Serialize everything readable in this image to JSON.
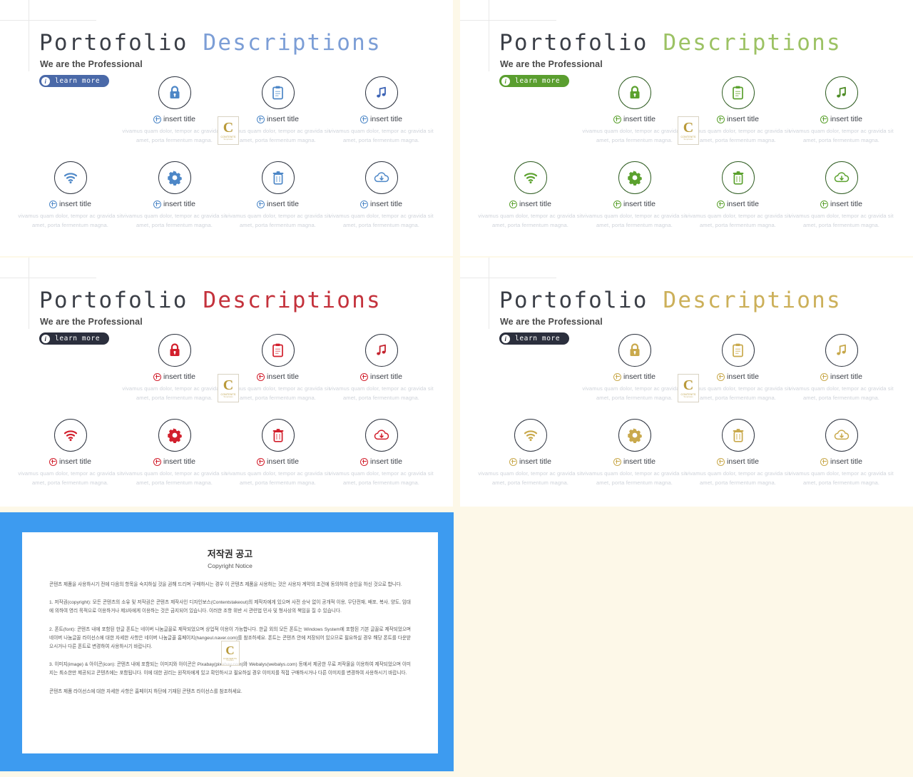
{
  "page": {
    "background": "#fdf8e8",
    "panel_background": "#ffffff"
  },
  "common": {
    "title_part1": "Portofolio",
    "title_part2": "Descriptions",
    "subtitle": "We are the Professional",
    "learn_more": "learn more",
    "info_glyph": "i",
    "cell_title": "insert title",
    "cell_body": "vivamus quam dolor, tempor ac gravida sit amet, porta fermentum magna.",
    "watermark": {
      "letter": "C",
      "line1": "CONTENTS",
      "line2": "Templates"
    },
    "icons_row1": [
      "lock-icon",
      "clipboard-icon",
      "music-note-icon"
    ],
    "icons_row2": [
      "wifi-icon",
      "gear-icon",
      "trash-icon",
      "cloud-download-icon"
    ]
  },
  "panels": [
    {
      "id": "panel-blue",
      "accent": "#4a69a8",
      "icon_color": "#4d87c7",
      "circle_border": "#2e3440",
      "button_bg": "#4a69a8",
      "button_text": "#ffffff",
      "title_accent": "#7c9ed6",
      "title_main": "#3b3f47",
      "plus_color": "#4d87c7"
    },
    {
      "id": "panel-green",
      "accent": "#5a9e2f",
      "icon_color": "#5ba12e",
      "circle_border": "#2f5d22",
      "button_bg": "#5a9e2f",
      "button_text": "#ffffff",
      "title_accent": "#9cc264",
      "title_main": "#3b3f47",
      "plus_color": "#5ba12e"
    },
    {
      "id": "panel-red",
      "accent": "#c4232e",
      "icon_color": "#d21f2c",
      "circle_border": "#2e3440",
      "button_bg": "#2b2f3d",
      "button_text": "#ffffff",
      "title_accent": "#c4323c",
      "title_main": "#3b3f47",
      "plus_color": "#d21f2c"
    },
    {
      "id": "panel-gold",
      "accent": "#c7a84b",
      "icon_color": "#c9a94c",
      "circle_border": "#2e3440",
      "button_bg": "#2b2f3d",
      "button_text": "#ffffff",
      "title_accent": "#ccb05a",
      "title_main": "#3b3f47",
      "plus_color": "#c9a94c"
    }
  ],
  "copyright": {
    "frame_color": "#3d9bf0",
    "title_ko": "저작권 공고",
    "title_en": "Copyright Notice",
    "intro": "콘텐츠 제품을 사용하시기 전에 다음의 항목을 숙지하실 것을 권해 드리며 구매하시는 경우 이 콘텐츠 제품을 사용하는 것은 사용자 계약의 조건에 동의하여 승인을 하신 것으로 합니다.",
    "p1": "1. 저작권(copyright): 모든 콘텐츠의 소유 및 저작권은 콘텐츠 제작사인 디자인보스(Contentstakeout)의 제작자에게 있으며 사전 승낙 없이 공개적 이용, 무단전재, 배포, 복사, 양도, 임대에 의하여 영리 목적으로 이용하거나 제3자에게 이용하는 것은 금지되어 있습니다. 이러한 조항 위반 시 관련법 민사 및 형사상의 책임을 질 수 있습니다.",
    "p2": "2. 폰트(font): 콘텐츠 내에 포함된 한글 폰트는 네이버 나눔글꼴로 제작되었으며 상업적 이용이 가능합니다. 한글 외의 모든 폰트는 Windows System에 포함된 기본 글꼴로 제작되었으며 네이버 나눔글꼴 라이선스에 대한 자세한 사항은 네이버 나눔글꼴 홈페이지(hangeul.naver.com)를 참조하세요. 폰트는 콘텐츠 안에 저장되어 있으므로 필요하실 경우 해당 폰트를 다운받으시거나 다른 폰트로 변경하여 사용하시기 바랍니다.",
    "p3": "3. 이미지(image) & 아이콘(icon): 콘텐츠 내에 포함되는 이미지와 아이콘은 Pixabay(pixabay.com)와 Webalys(webalys.com) 등에서 제공한 무료 저작물을 이용하여 제작되었으며 이미지는 최소한만 제공되고 콘텐츠에는 포함됩니다. 이에 대한 권리는 원작자에게 있고 확인하시고 필요하실 경우 이미지를 직접 구매하시거나 다른 이미지를 변경하여 사용하시기 바랍니다.",
    "p4": "콘텐츠 제품 라이선스에 대한 자세한 사항은 홈페이지 하단에 기재된 콘텐츠 라이선스를 참조하세요."
  }
}
